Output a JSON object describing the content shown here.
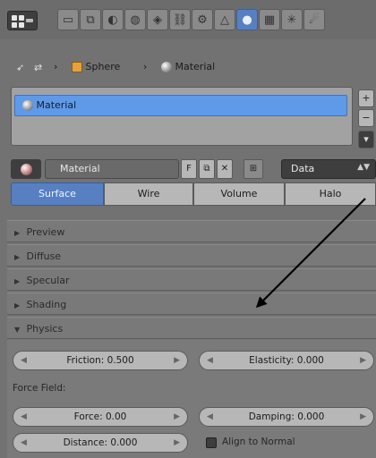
{
  "toolbar": {
    "context_icons": [
      "render-icon",
      "render-layers-icon",
      "scene-icon",
      "world-icon",
      "object-icon",
      "constraints-icon",
      "modifiers-icon",
      "data-icon",
      "material-icon",
      "texture-icon",
      "particles-icon",
      "physics-icon"
    ],
    "active_context": "material-icon"
  },
  "breadcrumb": {
    "object": "Sphere",
    "material": "Material",
    "separator": "›"
  },
  "slots": {
    "items": [
      "Material"
    ],
    "add_label": "+",
    "remove_label": "−",
    "menu_label": "▾"
  },
  "material": {
    "name": "Material",
    "fake_user_label": "F",
    "link_type": "Data"
  },
  "tabs": [
    {
      "label": "Surface",
      "active": true
    },
    {
      "label": "Wire",
      "active": false
    },
    {
      "label": "Volume",
      "active": false
    },
    {
      "label": "Halo",
      "active": false
    }
  ],
  "panels": {
    "preview": "Preview",
    "diffuse": "Diffuse",
    "specular": "Specular",
    "shading": "Shading",
    "physics": "Physics"
  },
  "physics": {
    "friction": "Friction: 0.500",
    "elasticity": "Elasticity: 0.000",
    "force_field_label": "Force Field:",
    "force": "Force: 0.00",
    "damping": "Damping: 0.000",
    "distance": "Distance: 0.000",
    "align_to_normal": "Align to Normal"
  },
  "colors": {
    "accent_blue": "#5680c2",
    "selection_blue": "#5f9ae8",
    "panel_bg": "#7a7a7a",
    "field_bg": "#b7b7b7"
  }
}
